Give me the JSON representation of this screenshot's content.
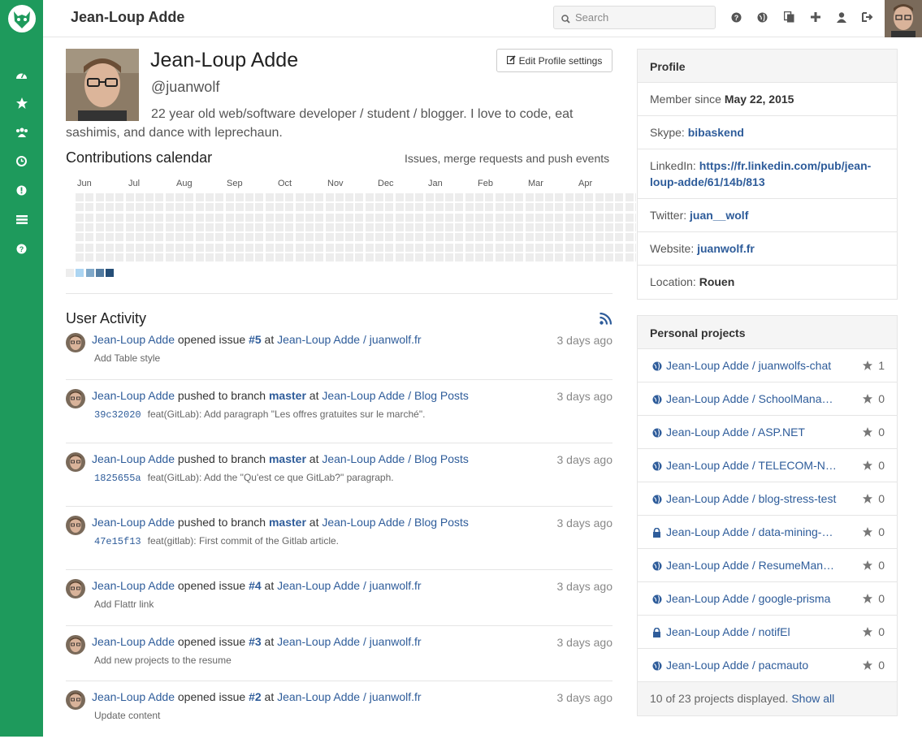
{
  "header": {
    "title": "Jean-Loup Adde",
    "search_placeholder": "Search"
  },
  "sidebar": {
    "items": [
      {
        "name": "dashboard-icon"
      },
      {
        "name": "star-icon"
      },
      {
        "name": "groups-icon"
      },
      {
        "name": "clock-icon"
      },
      {
        "name": "issues-icon"
      },
      {
        "name": "list-icon"
      },
      {
        "name": "help-icon"
      }
    ]
  },
  "profile": {
    "name": "Jean-Loup Adde",
    "handle": "@juanwolf",
    "bio": "22 year old web/software developer / student / blogger. I love to code, eat sashimis, and dance with leprechaun.",
    "edit_label": "Edit Profile settings"
  },
  "calendar": {
    "title": "Contributions calendar",
    "subtitle": "Issues, merge requests and push events",
    "months": [
      "Jun",
      "Jul",
      "Aug",
      "Sep",
      "Oct",
      "Nov",
      "Dec",
      "Jan",
      "Feb",
      "Mar",
      "Apr"
    ]
  },
  "activity": {
    "title": "User Activity",
    "events": [
      {
        "user": "Jean-Loup Adde",
        "action": "opened issue",
        "ref": "#5",
        "at": "at",
        "project": "Jean-Loup Adde / juanwolf.fr",
        "time": "3 days ago",
        "sha": "",
        "detail": "Add Table style"
      },
      {
        "user": "Jean-Loup Adde",
        "action": "pushed to branch",
        "ref": "master",
        "at": "at",
        "project": "Jean-Loup Adde / Blog Posts",
        "time": "3 days ago",
        "sha": "39c32020",
        "detail": "feat(GitLab): Add paragraph \"Les offres gratuites sur le marché\"."
      },
      {
        "user": "Jean-Loup Adde",
        "action": "pushed to branch",
        "ref": "master",
        "at": "at",
        "project": "Jean-Loup Adde / Blog Posts",
        "time": "3 days ago",
        "sha": "1825655a",
        "detail": "feat(GitLab): Add the \"Qu'est ce que GitLab?\" paragraph."
      },
      {
        "user": "Jean-Loup Adde",
        "action": "pushed to branch",
        "ref": "master",
        "at": "at",
        "project": "Jean-Loup Adde / Blog Posts",
        "time": "3 days ago",
        "sha": "47e15f13",
        "detail": "feat(gitlab): First commit of the Gitlab article."
      },
      {
        "user": "Jean-Loup Adde",
        "action": "opened issue",
        "ref": "#4",
        "at": "at",
        "project": "Jean-Loup Adde / juanwolf.fr",
        "time": "3 days ago",
        "sha": "",
        "detail": "Add Flattr link"
      },
      {
        "user": "Jean-Loup Adde",
        "action": "opened issue",
        "ref": "#3",
        "at": "at",
        "project": "Jean-Loup Adde / juanwolf.fr",
        "time": "3 days ago",
        "sha": "",
        "detail": "Add new projects to the resume"
      },
      {
        "user": "Jean-Loup Adde",
        "action": "opened issue",
        "ref": "#2",
        "at": "at",
        "project": "Jean-Loup Adde / juanwolf.fr",
        "time": "3 days ago",
        "sha": "",
        "detail": "Update content"
      }
    ]
  },
  "profile_panel": {
    "title": "Profile",
    "member_since_label": "Member since",
    "member_since": "May 22, 2015",
    "skype_label": "Skype:",
    "skype": "bibaskend",
    "linkedin_label": "LinkedIn:",
    "linkedin_1": "https://fr.linkedin.com/pub/jean-",
    "linkedin_2": "loup-adde/61/14b/813",
    "twitter_label": "Twitter:",
    "twitter": "juan__wolf",
    "website_label": "Website:",
    "website": "juanwolf.fr",
    "location_label": "Location:",
    "location": "Rouen"
  },
  "projects_panel": {
    "title": "Personal projects",
    "projects": [
      {
        "name": "Jean-Loup Adde / juanwolfs-chat",
        "stars": "1",
        "visibility": "public"
      },
      {
        "name": "Jean-Loup Adde / SchoolManagement",
        "stars": "0",
        "visibility": "public"
      },
      {
        "name": "Jean-Loup Adde / ASP.NET",
        "stars": "0",
        "visibility": "public"
      },
      {
        "name": "Jean-Loup Adde / TELECOM-Nancy",
        "stars": "0",
        "visibility": "public"
      },
      {
        "name": "Jean-Loup Adde / blog-stress-test",
        "stars": "0",
        "visibility": "public"
      },
      {
        "name": "Jean-Loup Adde / data-mining-project",
        "stars": "0",
        "visibility": "private"
      },
      {
        "name": "Jean-Loup Adde / ResumeManager",
        "stars": "0",
        "visibility": "public"
      },
      {
        "name": "Jean-Loup Adde / google-prisma",
        "stars": "0",
        "visibility": "public"
      },
      {
        "name": "Jean-Loup Adde / notifEl",
        "stars": "0",
        "visibility": "private"
      },
      {
        "name": "Jean-Loup Adde / pacmauto",
        "stars": "0",
        "visibility": "public"
      }
    ],
    "footer_text": "10 of 23 projects displayed.",
    "show_all": "Show all"
  },
  "colors": {
    "sidebar": "#1e9a5c",
    "link": "#2e5c9a",
    "cal_empty": "#ededed",
    "cal_levels": [
      "#ededed",
      "#acd5f2",
      "#7fa8c9",
      "#527ba0",
      "#254e77"
    ]
  }
}
